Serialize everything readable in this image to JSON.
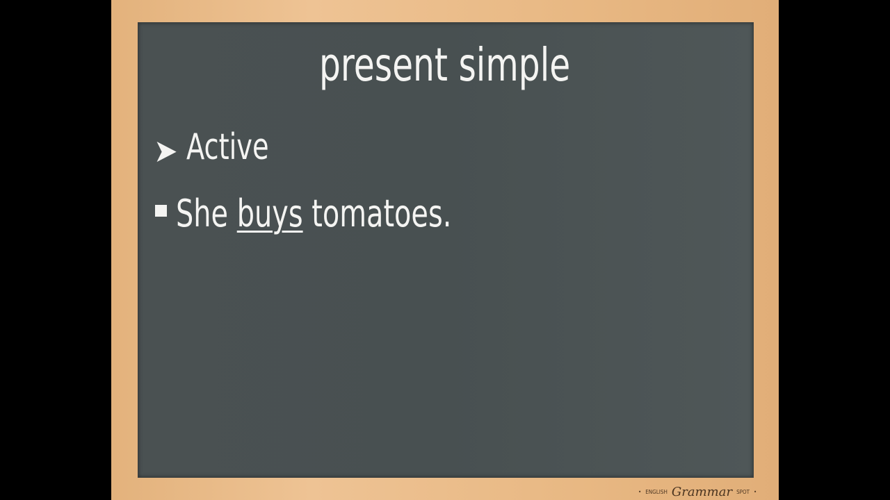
{
  "slide": {
    "title": "present simple",
    "heading": "Active",
    "bullet": {
      "before": "She ",
      "underlined": "buys",
      "after": " tomatoes."
    },
    "icons": {
      "heading_marker": "arrowhead-bullet-icon",
      "list_marker": "square-bullet-icon"
    }
  },
  "logo": {
    "left": "ENGLISH",
    "main": "Grammar",
    "right": "SPOT"
  },
  "colors": {
    "board": "#4a5152",
    "frame": "#e8b883",
    "chalk": "#f4f4f2"
  }
}
